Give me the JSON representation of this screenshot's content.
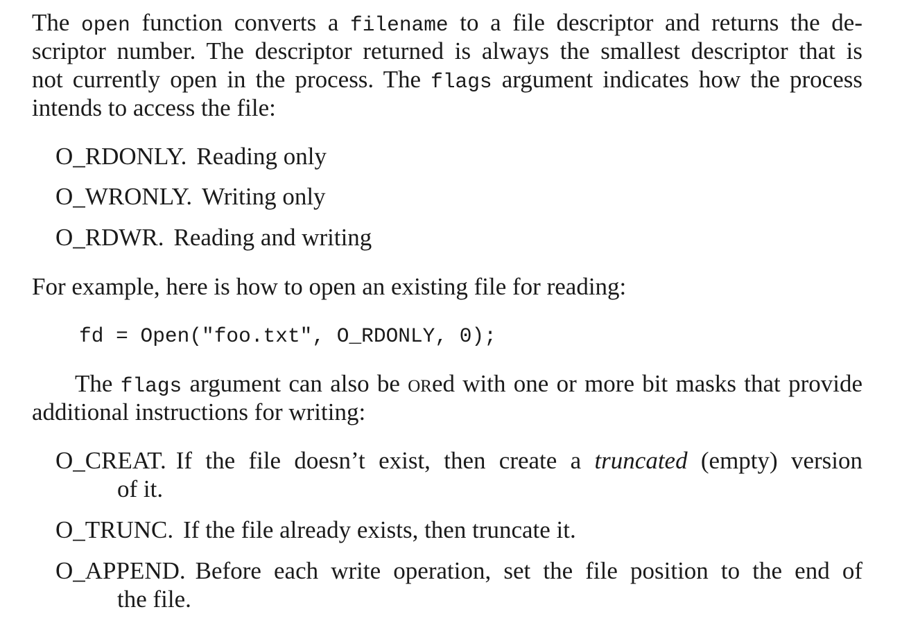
{
  "para1": {
    "l1_a": "The ",
    "l1_code1": "open",
    "l1_b": " function converts a ",
    "l1_code2": "filename",
    "l1_c": " to a file descriptor and returns the de-",
    "l2": "scriptor number. The descriptor returned is always the smallest descriptor that is",
    "l3_a": "not currently open in the process. The ",
    "l3_code": "flags",
    "l3_b": " argument indicates how the process",
    "l4": "intends to access the file:"
  },
  "access_flags": [
    {
      "term": "O_RDONLY.",
      "desc": "Reading only"
    },
    {
      "term": "O_WRONLY.",
      "desc": "Writing only"
    },
    {
      "term": "O_RDWR.",
      "desc": "Reading and writing"
    }
  ],
  "para2": "For example, here is how to open an existing file for reading:",
  "code_example": "fd = Open(\"foo.txt\", O_RDONLY, 0);",
  "para3": {
    "l1_a": "The ",
    "l1_code": "flags",
    "l1_b": " argument can also be ",
    "l1_sc": "or",
    "l1_c": "ed with one or more bit masks that provide",
    "l2": "additional instructions for writing:"
  },
  "write_flags": {
    "creat": {
      "term": "O_CREAT.",
      "desc_a": "If the file doesn’t exist, then create a ",
      "desc_em": "truncated",
      "desc_b": " (empty) version",
      "cont": "of it."
    },
    "trunc": {
      "term": "O_TRUNC.",
      "desc": "If the file already exists, then truncate it."
    },
    "append": {
      "term": "O_APPEND.",
      "desc": "Before each write operation, set the file position to the end of",
      "cont": "the file."
    }
  }
}
